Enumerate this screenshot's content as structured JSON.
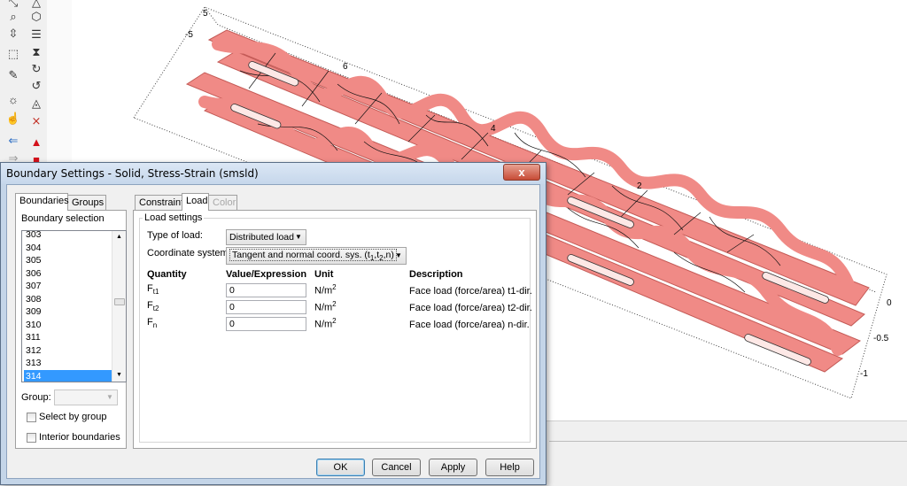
{
  "dialog": {
    "title": "Boundary Settings - Solid, Stress-Strain (smsld)",
    "close_glyph": "x"
  },
  "left_tabs": [
    {
      "label": "Boundaries",
      "active": true
    },
    {
      "label": "Groups",
      "active": false
    }
  ],
  "boundary_selection": {
    "label": "Boundary selection",
    "items": [
      "303",
      "304",
      "305",
      "306",
      "307",
      "308",
      "309",
      "310",
      "311",
      "312",
      "313",
      "314"
    ],
    "selected": "314"
  },
  "group": {
    "label": "Group:",
    "value": ""
  },
  "checkboxes": {
    "select_by_group": {
      "label": "Select by group",
      "checked": false
    },
    "interior_boundaries": {
      "label": "Interior boundaries",
      "checked": false
    }
  },
  "right_tabs": [
    {
      "label": "Constraint",
      "active": false,
      "disabled": false
    },
    {
      "label": "Load",
      "active": true,
      "disabled": false
    },
    {
      "label": "Color",
      "active": false,
      "disabled": true
    }
  ],
  "load_settings": {
    "group_label": "Load settings",
    "type_of_load_label": "Type of load:",
    "type_of_load_value": "Distributed load",
    "coord_system_label": "Coordinate system:",
    "coord_system_value_prefix": "Tangent and normal coord. sys. (t",
    "coord_system_sub1": "1",
    "coord_system_comma": ",t",
    "coord_system_sub2": "2",
    "coord_system_suffix": ",n)"
  },
  "table": {
    "headers": {
      "quantity": "Quantity",
      "value": "Value/Expression",
      "unit": "Unit",
      "description": "Description"
    },
    "rows": [
      {
        "q_base": "F",
        "q_sub": "t1",
        "value": "0",
        "unit_base": "N/m",
        "unit_sup": "2",
        "description": "Face load (force/area) t1-dir."
      },
      {
        "q_base": "F",
        "q_sub": "t2",
        "value": "0",
        "unit_base": "N/m",
        "unit_sup": "2",
        "description": "Face load (force/area) t2-dir."
      },
      {
        "q_base": "F",
        "q_sub": "n",
        "value": "0",
        "unit_base": "N/m",
        "unit_sup": "2",
        "description": "Face load (force/area) n-dir."
      }
    ]
  },
  "buttons": {
    "ok": "OK",
    "cancel": "Cancel",
    "apply": "Apply",
    "help": "Help"
  },
  "axis_labels": {
    "top": [
      "5",
      "-5"
    ],
    "x_ticks": [
      "6",
      "4",
      "2"
    ],
    "right_ticks": [
      "0",
      "-0.5",
      "-1"
    ]
  },
  "colors": {
    "accent_selection": "#3399ff",
    "geometry_fill": "#f08a86",
    "titlebar": "#c4d5e8",
    "close_button": "#c74b36"
  },
  "toolbar_icons": [
    "zoom-in-icon",
    "zoom-icon",
    "pan-icon",
    "select-icon",
    "lasso-icon",
    "probe-icon",
    "light-icon",
    "hand-icon",
    "arrow-left-icon",
    "arrow-right-icon",
    "view-left-icon",
    "view-2-icon",
    "view-3-icon",
    "view-4-icon",
    "view-5-icon",
    "view-6-icon",
    "view-7-icon",
    "view-8-icon",
    "warning-icon",
    "stop-icon"
  ]
}
